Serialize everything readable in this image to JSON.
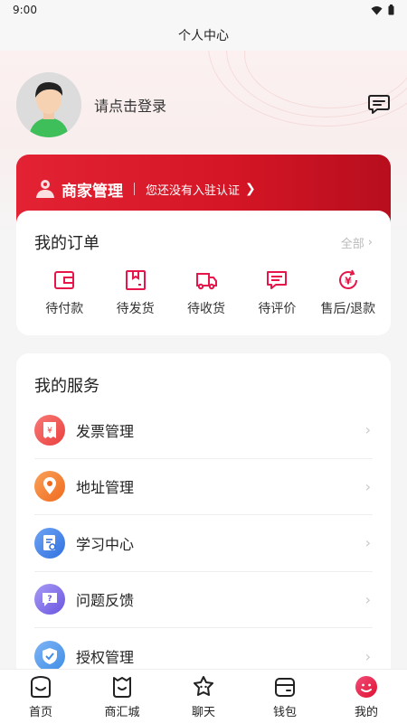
{
  "status_bar": {
    "time": "9:00"
  },
  "header": {
    "title": "个人中心"
  },
  "profile": {
    "login_prompt": "请点击登录"
  },
  "merchant": {
    "title": "商家管理",
    "subtitle": "您还没有入驻认证"
  },
  "orders": {
    "title": "我的订单",
    "see_all": "全部",
    "items": [
      {
        "label": "待付款",
        "icon": "wallet-icon"
      },
      {
        "label": "待发货",
        "icon": "package-icon"
      },
      {
        "label": "待收货",
        "icon": "truck-icon"
      },
      {
        "label": "待评价",
        "icon": "comment-icon"
      },
      {
        "label": "售后/退款",
        "icon": "refund-icon"
      }
    ]
  },
  "services": {
    "title": "我的服务",
    "items": [
      {
        "label": "发票管理",
        "icon": "invoice-icon",
        "color": "#f0504f"
      },
      {
        "label": "地址管理",
        "icon": "location-icon",
        "color": "#f47c2a"
      },
      {
        "label": "学习中心",
        "icon": "study-icon",
        "color": "#3f7fe6"
      },
      {
        "label": "问题反馈",
        "icon": "feedback-icon",
        "color": "#7c6ae6"
      },
      {
        "label": "授权管理",
        "icon": "shield-icon",
        "color": "#3f8ee6"
      }
    ]
  },
  "tabbar": {
    "items": [
      {
        "label": "首页",
        "icon": "home-icon"
      },
      {
        "label": "商汇城",
        "icon": "shopping-bag-icon"
      },
      {
        "label": "聊天",
        "icon": "chat-icon"
      },
      {
        "label": "钱包",
        "icon": "wallet-icon"
      },
      {
        "label": "我的",
        "icon": "profile-icon",
        "active": true
      }
    ]
  },
  "colors": {
    "accent": "#e32334",
    "active_tab": "#e6154a"
  }
}
